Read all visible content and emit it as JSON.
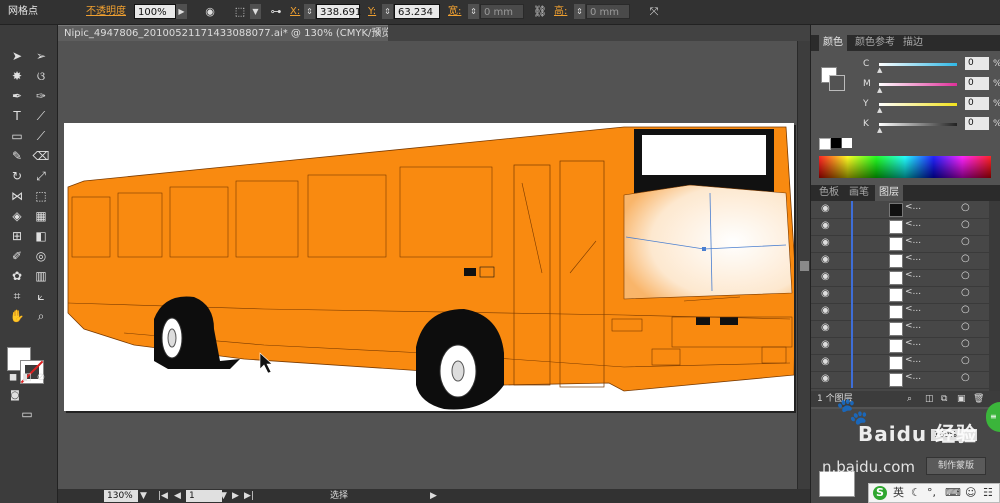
{
  "control_bar": {
    "mode_label": "网格点",
    "opacity_label": "不透明度",
    "opacity_value": "100%",
    "x_label": "X:",
    "x_value": "338.691",
    "y_label": "Y:",
    "y_value": "63.234",
    "width_label": "宽:",
    "width_value": "0 mm",
    "height_label": "高:",
    "height_value": "0 mm"
  },
  "document": {
    "tab_title": "Nipic_4947806_20100521171433088077.ai* @ 130% (CMYK/预览)",
    "close": "×"
  },
  "status_bar": {
    "zoom": "130%",
    "page": "1",
    "tool": "选择"
  },
  "color_panel": {
    "tabs": [
      "颜色",
      "颜色参考",
      "描边"
    ],
    "channels": [
      {
        "label": "C",
        "value": "0",
        "unit": "%",
        "color": "#2fb8e6"
      },
      {
        "label": "M",
        "value": "0",
        "unit": "%",
        "color": "#e0309a"
      },
      {
        "label": "Y",
        "value": "0",
        "unit": "%",
        "color": "#f2e21c"
      },
      {
        "label": "K",
        "value": "0",
        "unit": "%",
        "color": "#222222"
      }
    ]
  },
  "layers_panel": {
    "tabs": [
      "色板",
      "画笔",
      "图层"
    ],
    "rows": [
      {
        "name": "<..."
      },
      {
        "name": "<..."
      },
      {
        "name": "<..."
      },
      {
        "name": "<..."
      },
      {
        "name": "<..."
      },
      {
        "name": "<..."
      },
      {
        "name": "<..."
      },
      {
        "name": "<..."
      },
      {
        "name": "<..."
      },
      {
        "name": "<..."
      },
      {
        "name": "<..."
      }
    ],
    "count_label": "1 个图层"
  },
  "navigator": {
    "zoom": "100%",
    "button": "制作蒙版"
  },
  "watermark": {
    "text1": "Baidu 经验",
    "text2": "n.baidu.com"
  },
  "ime": {
    "logo": "S",
    "lang": "英"
  },
  "colors": {
    "bus_orange": "#f98a10",
    "canvas_gray": "#535353",
    "selection_blue": "#4a7fd0"
  }
}
